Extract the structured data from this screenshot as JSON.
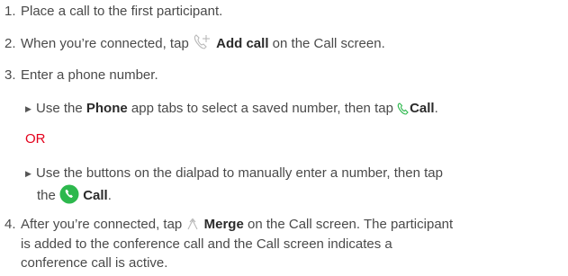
{
  "steps": [
    {
      "num": "1.",
      "text": "Place a call to the first participant."
    },
    {
      "num": "2.",
      "text_before": "When you’re connected, tap",
      "bold": "Add call",
      "text_after": "on the Call screen."
    },
    {
      "num": "3.",
      "text": "Enter a phone number."
    },
    {
      "num": "4.",
      "text_before": "After you’re connected, tap",
      "bold": "Merge",
      "text_after": "on the Call screen. The participant",
      "line2": "is added to the conference call and the Call screen indicates a",
      "line3": "conference call is active."
    }
  ],
  "substeps": {
    "first": {
      "text_before": "Use the",
      "bold_app": "Phone",
      "text_mid": "app tabs to select a saved number, then tap",
      "bold": "Call",
      "text_after": "."
    },
    "or_label": "OR",
    "second": {
      "line1": "Use the buttons on the dialpad to manually enter a number, then tap",
      "text_before": "the",
      "bold": "Call",
      "text_after": "."
    }
  },
  "icons": {
    "add_call": "phone-plus-icon",
    "call_small": "phone-icon",
    "call_green": "green-phone-button-icon",
    "merge": "merge-arrows-icon",
    "bullet": "triangle-bullet-icon"
  },
  "colors": {
    "text": "#4a4a4a",
    "bold": "#2b2b2b",
    "or": "#e4001b",
    "call_green": "#2db84d"
  }
}
